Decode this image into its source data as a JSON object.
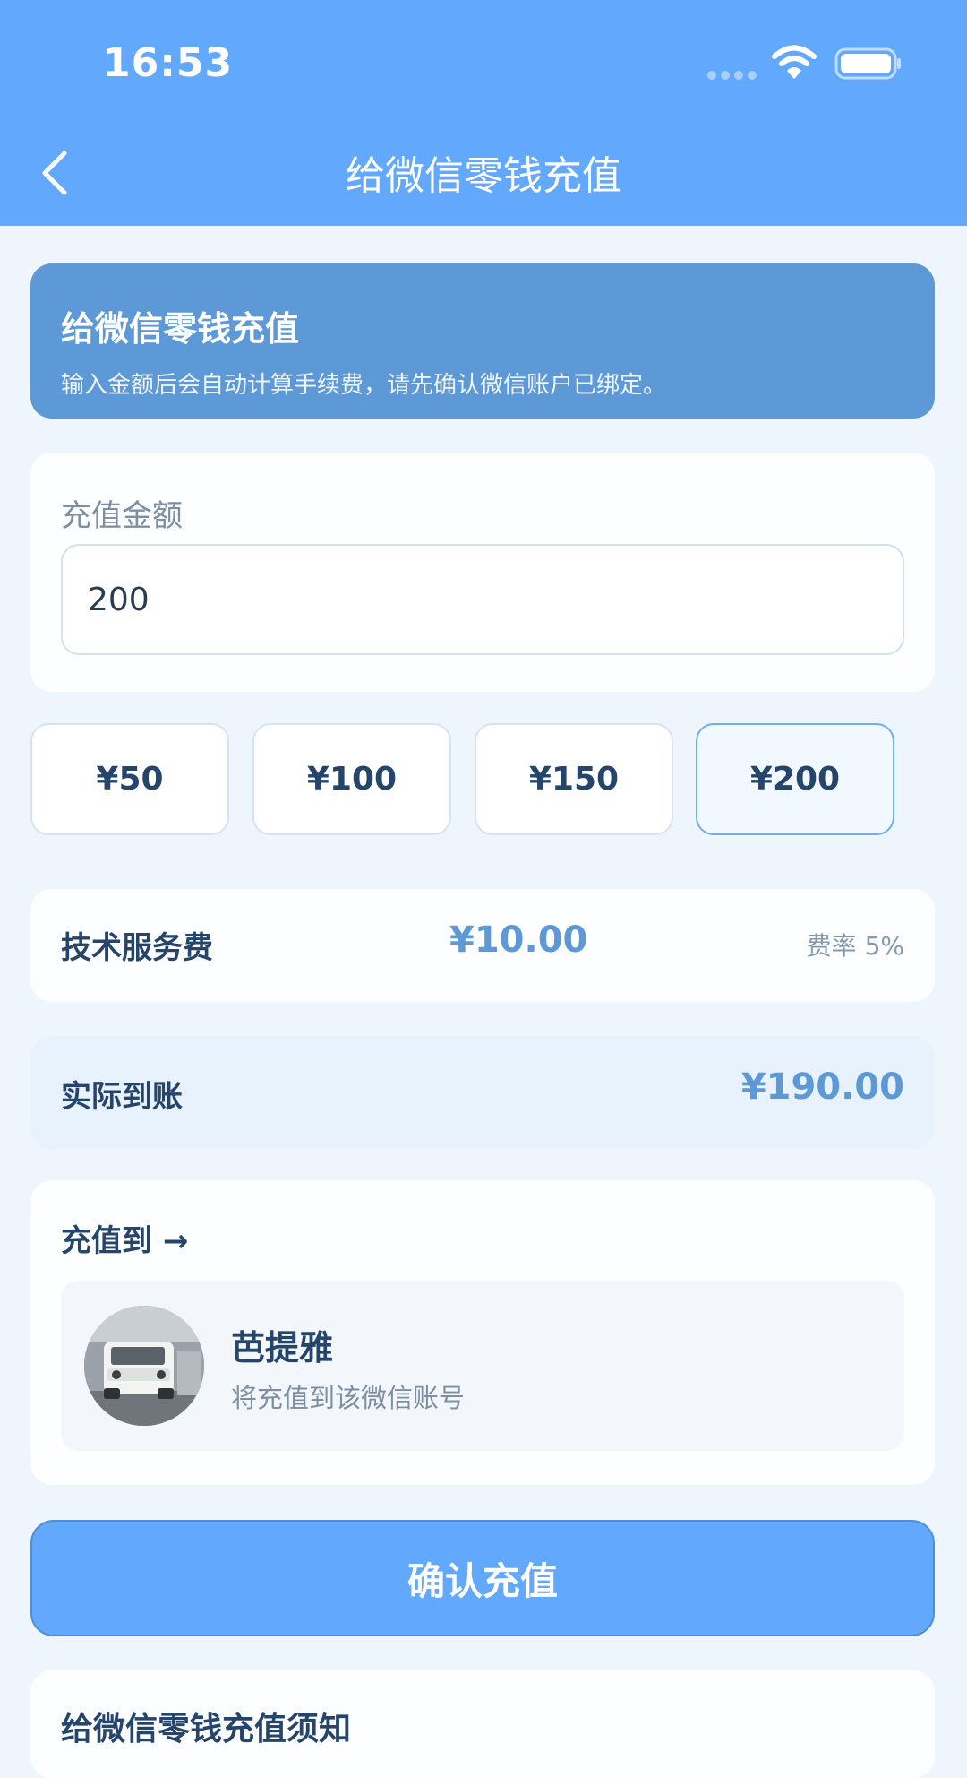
{
  "status_bar": {
    "time": "16:53"
  },
  "nav": {
    "title": "给微信零钱充值"
  },
  "banner": {
    "title": "给微信零钱充值",
    "subtitle": "输入金额后会自动计算手续费，请先确认微信账户已绑定。"
  },
  "amount": {
    "label": "充值金额",
    "value": "200"
  },
  "presets": [
    {
      "label": "¥50",
      "selected": false
    },
    {
      "label": "¥100",
      "selected": false
    },
    {
      "label": "¥150",
      "selected": false
    },
    {
      "label": "¥200",
      "selected": true
    }
  ],
  "fee": {
    "label": "技术服务费",
    "value": "¥10.00",
    "rate": "费率 5%"
  },
  "actual": {
    "label": "实际到账",
    "value": "¥190.00"
  },
  "recipient": {
    "title": "充值到 →",
    "name": "芭提雅",
    "description": "将充值到该微信账号"
  },
  "confirm_button": {
    "label": "确认充值"
  },
  "notice": {
    "title": "给微信零钱充值须知"
  },
  "colors": {
    "primary": "#62a8fd",
    "banner": "#5d99d6",
    "text_dark": "#26456b",
    "text_muted": "#7d8fa4",
    "background": "#eef5fd"
  }
}
